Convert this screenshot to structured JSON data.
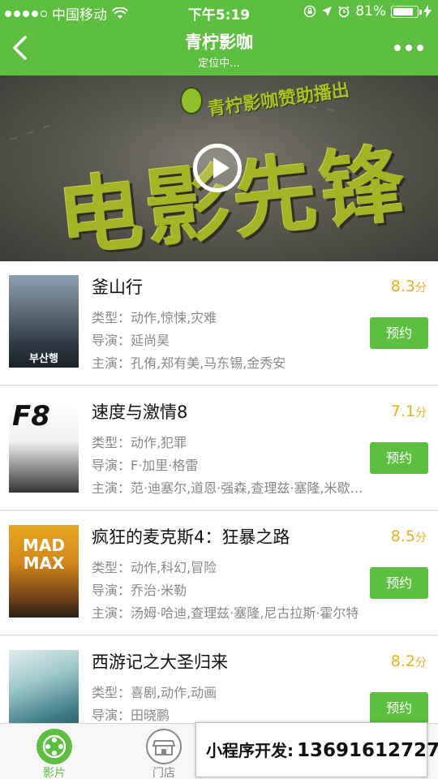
{
  "status_bar": {
    "carrier": "中国移动",
    "time": "下午5:19",
    "battery": "81%",
    "battery_level": 0.81
  },
  "nav": {
    "title": "青柠影咖",
    "subtitle": "定位中..."
  },
  "banner": {
    "brand_text": "青柠影咖赞助播出",
    "headline": "电影先锋"
  },
  "movies": [
    {
      "title": "釜山行",
      "score": "8.3",
      "score_unit": "分",
      "genre": "类型：动作,惊悚,灾难",
      "director": "导演：延尚昊",
      "cast": "主演：孔侑,郑有美,马东锡,金秀安",
      "book_label": "预约",
      "poster_text": "부산행"
    },
    {
      "title": "速度与激情8",
      "score": "7.1",
      "score_unit": "分",
      "genre": "类型：动作,犯罪",
      "director": "导演：F·加里·格雷",
      "cast": "主演：范·迪塞尔,道恩·强森,查理兹·塞隆,米歇尔·罗德里格兹",
      "book_label": "预约",
      "poster_text": "F8"
    },
    {
      "title": "疯狂的麦克斯4：狂暴之路",
      "score": "8.5",
      "score_unit": "分",
      "genre": "类型：动作,科幻,冒险",
      "director": "导演：乔治·米勒",
      "cast": "主演：汤姆·哈迪,查理兹·塞隆,尼古拉斯·霍尔特",
      "book_label": "预约",
      "poster_text": "MAD MAX"
    },
    {
      "title": "西游记之大圣归来",
      "score": "8.2",
      "score_unit": "分",
      "genre": "类型：喜剧,动作,动画",
      "director": "导演：田晓鹏",
      "cast": "",
      "book_label": "预约",
      "poster_text": ""
    }
  ],
  "tabbar": {
    "tab1_label": "影片",
    "tab2_label": "门店"
  },
  "promo": {
    "label": "小程序开发:",
    "phone": "13691612727"
  },
  "colors": {
    "brand_green": "#5cbf3f",
    "score_orange": "#e9b020"
  }
}
